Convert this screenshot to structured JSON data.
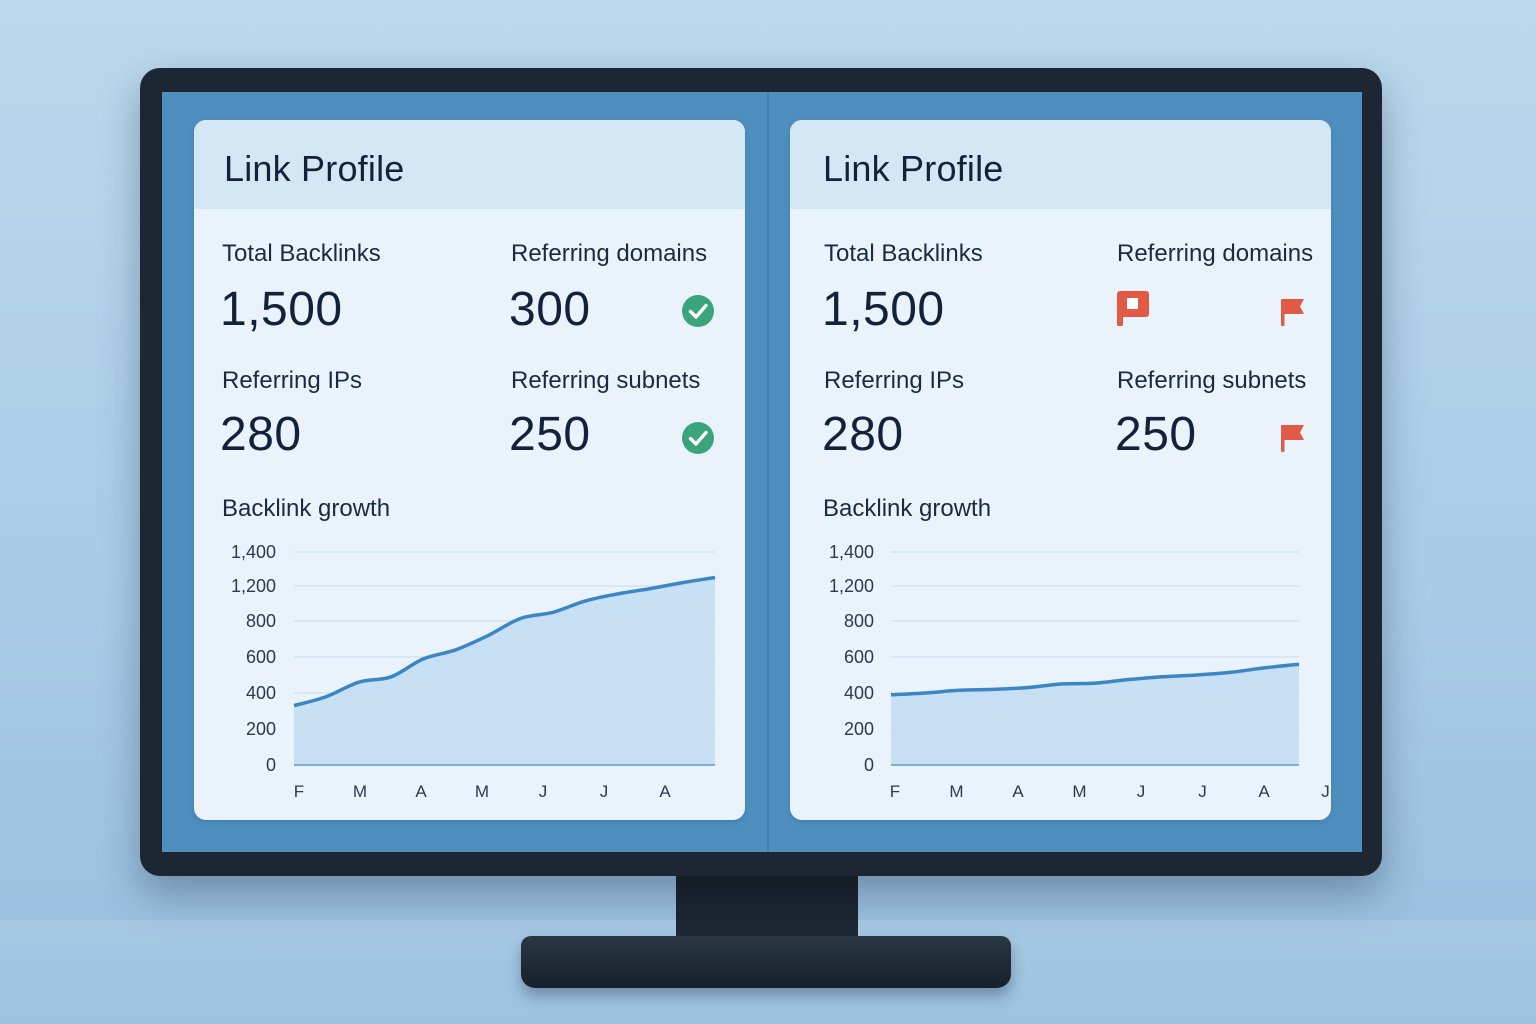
{
  "colors": {
    "accent_line": "#3b87c6",
    "area_fill": "#c2dcf1",
    "ok_green": "#3aa57a",
    "flag_red": "#e05a45",
    "text_dark": "#13223a"
  },
  "panels": [
    {
      "title": "Link Profile",
      "stats": [
        {
          "label": "Total Backlinks",
          "value": "1,500",
          "status_icon": ""
        },
        {
          "label": "Referring domains",
          "value": "300",
          "status_icon": "check-icon"
        },
        {
          "label": "Referring IPs",
          "value": "280",
          "status_icon": ""
        },
        {
          "label": "Referring subnets",
          "value": "250",
          "status_icon": "check-icon"
        }
      ],
      "chart_title": "Backlink growth"
    },
    {
      "title": "Link Profile",
      "stats": [
        {
          "label": "Total Backlinks",
          "value": "1,500",
          "status_icon": ""
        },
        {
          "label": "Referring domains",
          "value": "",
          "status_icon": "flag-icon"
        },
        {
          "label": "Referring IPs",
          "value": "280",
          "status_icon": ""
        },
        {
          "label": "Referring subnets",
          "value": "250",
          "status_icon": "flag-icon"
        }
      ],
      "extra_icon": "warning-square-icon",
      "chart_title": "Backlink growth"
    }
  ],
  "chart_data": [
    {
      "type": "area",
      "title": "Backlink growth",
      "xlabel": "",
      "ylabel": "",
      "y_ticks": [
        "0",
        "200",
        "400",
        "600",
        "800",
        "1,200",
        "1,400"
      ],
      "x_ticks": [
        "F",
        "M",
        "A",
        "M",
        "J",
        "J",
        "A"
      ],
      "ylim": [
        0,
        1400
      ],
      "grid": true,
      "series": [
        {
          "values": [
            330,
            380,
            460,
            490,
            590,
            640,
            720,
            830,
            900,
            1030,
            1110,
            1170,
            1220,
            1250
          ]
        }
      ]
    },
    {
      "type": "area",
      "title": "Backlink growth",
      "xlabel": "",
      "ylabel": "",
      "y_ticks": [
        "0",
        "200",
        "400",
        "600",
        "800",
        "1,200",
        "1,400"
      ],
      "x_ticks": [
        "F",
        "M",
        "A",
        "M",
        "J",
        "J",
        "A",
        "J"
      ],
      "ylim": [
        0,
        1400
      ],
      "grid": true,
      "series": [
        {
          "values": [
            390,
            400,
            415,
            420,
            430,
            450,
            455,
            475,
            490,
            500,
            515,
            540,
            560
          ]
        }
      ]
    }
  ]
}
